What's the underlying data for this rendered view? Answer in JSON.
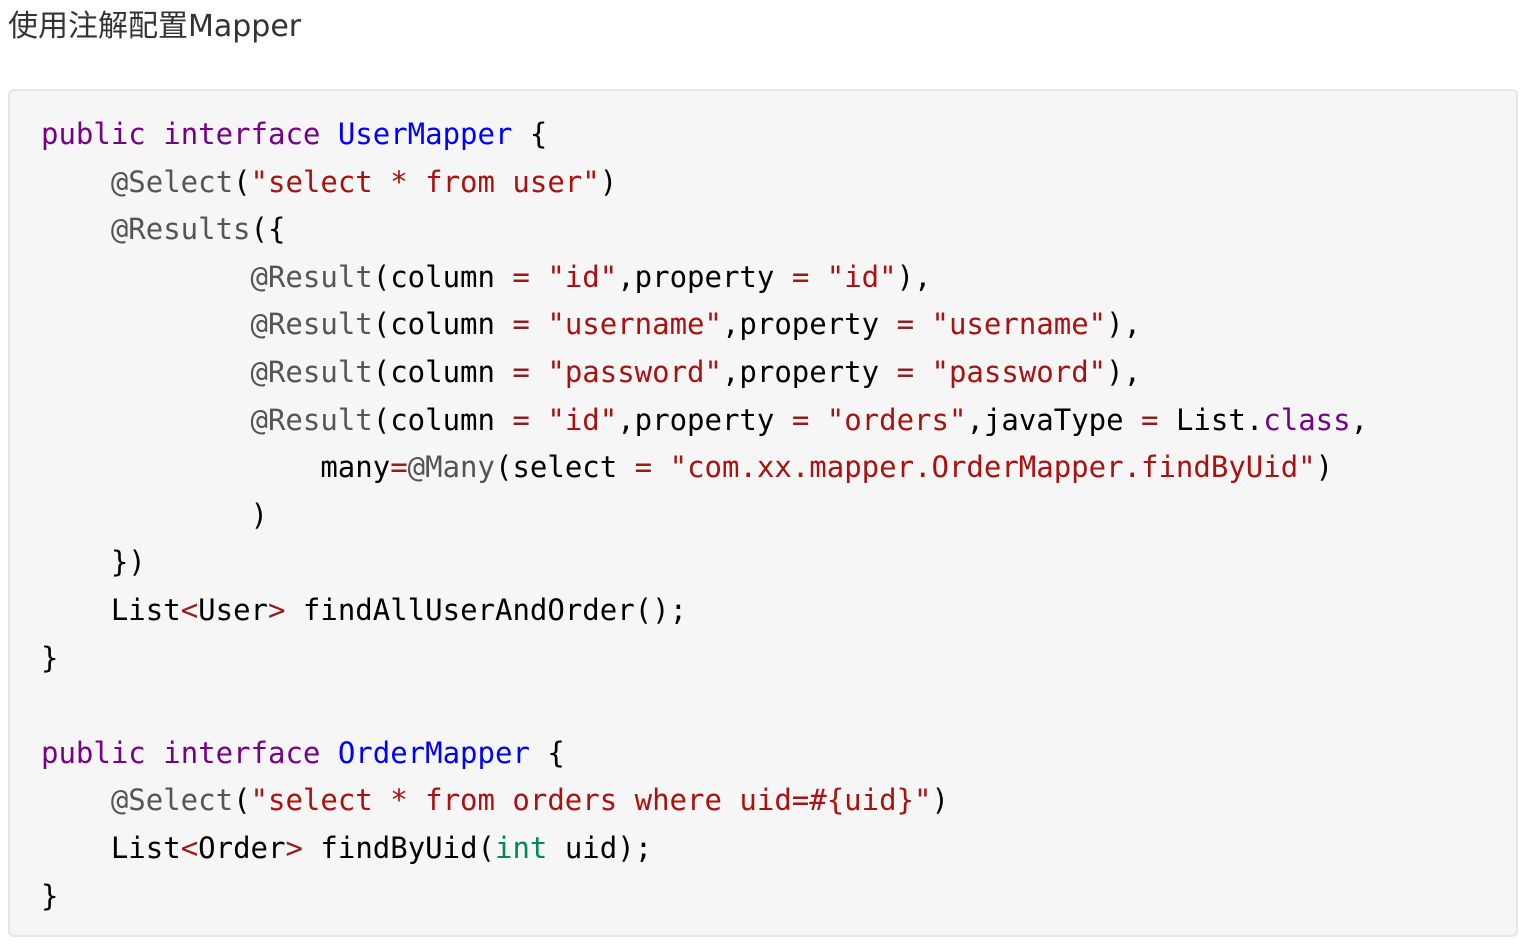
{
  "heading": "使用注解配置Mapper",
  "code": {
    "language": "java",
    "lines": [
      [
        {
          "t": "kw",
          "v": "public"
        },
        {
          "t": "plain",
          "v": " "
        },
        {
          "t": "kw",
          "v": "interface"
        },
        {
          "t": "plain",
          "v": " "
        },
        {
          "t": "def",
          "v": "UserMapper"
        },
        {
          "t": "plain",
          "v": " {"
        }
      ],
      [
        {
          "t": "plain",
          "v": "    "
        },
        {
          "t": "meta",
          "v": "@Select"
        },
        {
          "t": "plain",
          "v": "("
        },
        {
          "t": "str",
          "v": "\"select * from user\""
        },
        {
          "t": "plain",
          "v": ")"
        }
      ],
      [
        {
          "t": "plain",
          "v": "    "
        },
        {
          "t": "meta",
          "v": "@Results"
        },
        {
          "t": "plain",
          "v": "({"
        }
      ],
      [
        {
          "t": "plain",
          "v": "            "
        },
        {
          "t": "meta",
          "v": "@Result"
        },
        {
          "t": "plain",
          "v": "(column "
        },
        {
          "t": "op",
          "v": "="
        },
        {
          "t": "plain",
          "v": " "
        },
        {
          "t": "str",
          "v": "\"id\""
        },
        {
          "t": "plain",
          "v": ",property "
        },
        {
          "t": "op",
          "v": "="
        },
        {
          "t": "plain",
          "v": " "
        },
        {
          "t": "str",
          "v": "\"id\""
        },
        {
          "t": "plain",
          "v": "),"
        }
      ],
      [
        {
          "t": "plain",
          "v": "            "
        },
        {
          "t": "meta",
          "v": "@Result"
        },
        {
          "t": "plain",
          "v": "(column "
        },
        {
          "t": "op",
          "v": "="
        },
        {
          "t": "plain",
          "v": " "
        },
        {
          "t": "str",
          "v": "\"username\""
        },
        {
          "t": "plain",
          "v": ",property "
        },
        {
          "t": "op",
          "v": "="
        },
        {
          "t": "plain",
          "v": " "
        },
        {
          "t": "str",
          "v": "\"username\""
        },
        {
          "t": "plain",
          "v": "),"
        }
      ],
      [
        {
          "t": "plain",
          "v": "            "
        },
        {
          "t": "meta",
          "v": "@Result"
        },
        {
          "t": "plain",
          "v": "(column "
        },
        {
          "t": "op",
          "v": "="
        },
        {
          "t": "plain",
          "v": " "
        },
        {
          "t": "str",
          "v": "\"password\""
        },
        {
          "t": "plain",
          "v": ",property "
        },
        {
          "t": "op",
          "v": "="
        },
        {
          "t": "plain",
          "v": " "
        },
        {
          "t": "str",
          "v": "\"password\""
        },
        {
          "t": "plain",
          "v": "),"
        }
      ],
      [
        {
          "t": "plain",
          "v": "            "
        },
        {
          "t": "meta",
          "v": "@Result"
        },
        {
          "t": "plain",
          "v": "(column "
        },
        {
          "t": "op",
          "v": "="
        },
        {
          "t": "plain",
          "v": " "
        },
        {
          "t": "str",
          "v": "\"id\""
        },
        {
          "t": "plain",
          "v": ",property "
        },
        {
          "t": "op",
          "v": "="
        },
        {
          "t": "plain",
          "v": " "
        },
        {
          "t": "str",
          "v": "\"orders\""
        },
        {
          "t": "plain",
          "v": ",javaType "
        },
        {
          "t": "op",
          "v": "="
        },
        {
          "t": "plain",
          "v": " List."
        },
        {
          "t": "kw",
          "v": "class"
        },
        {
          "t": "plain",
          "v": ","
        }
      ],
      [
        {
          "t": "plain",
          "v": "                many"
        },
        {
          "t": "op",
          "v": "="
        },
        {
          "t": "meta",
          "v": "@Many"
        },
        {
          "t": "plain",
          "v": "(select "
        },
        {
          "t": "op",
          "v": "="
        },
        {
          "t": "plain",
          "v": " "
        },
        {
          "t": "str",
          "v": "\"com.xx.mapper.OrderMapper.findByUid\""
        },
        {
          "t": "plain",
          "v": ")"
        }
      ],
      [
        {
          "t": "plain",
          "v": "            )"
        }
      ],
      [
        {
          "t": "plain",
          "v": "    })"
        }
      ],
      [
        {
          "t": "plain",
          "v": "    List"
        },
        {
          "t": "op",
          "v": "<"
        },
        {
          "t": "plain",
          "v": "User"
        },
        {
          "t": "op",
          "v": ">"
        },
        {
          "t": "plain",
          "v": " findAllUserAndOrder();"
        }
      ],
      [
        {
          "t": "plain",
          "v": "}"
        }
      ],
      [
        {
          "t": "plain",
          "v": ""
        }
      ],
      [
        {
          "t": "kw",
          "v": "public"
        },
        {
          "t": "plain",
          "v": " "
        },
        {
          "t": "kw",
          "v": "interface"
        },
        {
          "t": "plain",
          "v": " "
        },
        {
          "t": "def",
          "v": "OrderMapper"
        },
        {
          "t": "plain",
          "v": " {"
        }
      ],
      [
        {
          "t": "plain",
          "v": "    "
        },
        {
          "t": "meta",
          "v": "@Select"
        },
        {
          "t": "plain",
          "v": "("
        },
        {
          "t": "str",
          "v": "\"select * from orders where uid=#{uid}\""
        },
        {
          "t": "plain",
          "v": ")"
        }
      ],
      [
        {
          "t": "plain",
          "v": "    List"
        },
        {
          "t": "op",
          "v": "<"
        },
        {
          "t": "plain",
          "v": "Order"
        },
        {
          "t": "op",
          "v": ">"
        },
        {
          "t": "plain",
          "v": " findByUid("
        },
        {
          "t": "type",
          "v": "int"
        },
        {
          "t": "plain",
          "v": " uid);"
        }
      ],
      [
        {
          "t": "plain",
          "v": "}"
        }
      ]
    ]
  },
  "colors": {
    "keyword": "#770088",
    "definition": "#0000ff",
    "annotation": "#555555",
    "string": "#aa1111",
    "operator": "#981a1a",
    "type": "#008855",
    "code_background": "#f6f6f6",
    "heading_text": "#333333"
  }
}
